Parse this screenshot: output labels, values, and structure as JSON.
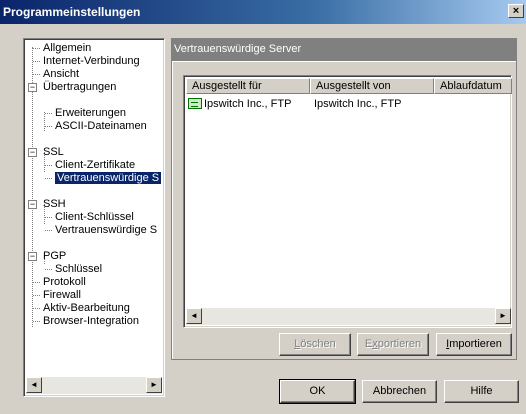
{
  "window": {
    "title": "Programmeinstellungen",
    "close_glyph": "×"
  },
  "tree": {
    "items": [
      {
        "label": "Allgemein"
      },
      {
        "label": "Internet-Verbindung"
      },
      {
        "label": "Ansicht"
      },
      {
        "label": "Übertragungen"
      },
      {
        "label": "Erweiterungen"
      },
      {
        "label": "ASCII-Dateinamen"
      },
      {
        "label": "SSL"
      },
      {
        "label": "Client-Zertifikate"
      },
      {
        "label": "Vertrauenswürdige S"
      },
      {
        "label": "SSH"
      },
      {
        "label": "Client-Schlüssel"
      },
      {
        "label": "Vertrauenswürdige S"
      },
      {
        "label": "PGP"
      },
      {
        "label": "Schlüssel"
      },
      {
        "label": "Protokoll"
      },
      {
        "label": "Firewall"
      },
      {
        "label": "Aktiv-Bearbeitung"
      },
      {
        "label": "Browser-Integration"
      }
    ],
    "expander_minus": "−"
  },
  "panel": {
    "title": "Vertrauenswürdige Server",
    "columns": [
      "Ausgestellt für",
      "Ausgestellt von",
      "Ablaufdatum"
    ],
    "rows": [
      {
        "issued_for": "Ipswitch Inc., FTP",
        "issued_by": "Ipswitch Inc., FTP",
        "expires": ""
      }
    ]
  },
  "buttons": {
    "delete": {
      "pre": "",
      "acc": "L",
      "post": "öschen"
    },
    "export": {
      "pre": "E",
      "acc": "x",
      "post": "portieren"
    },
    "import": {
      "pre": "",
      "acc": "I",
      "post": "mportieren"
    },
    "ok": "OK",
    "cancel": "Abbrechen",
    "help": "Hilfe"
  },
  "scroll": {
    "left": "◄",
    "right": "►"
  }
}
